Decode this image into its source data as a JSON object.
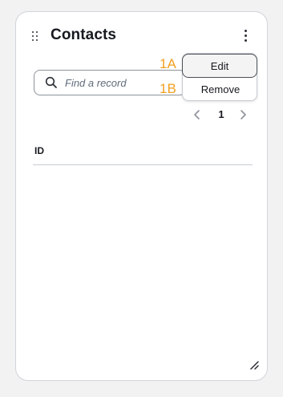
{
  "widget": {
    "title": "Contacts"
  },
  "search": {
    "placeholder": "Find a record"
  },
  "menu": {
    "items": [
      {
        "label": "Edit",
        "hint": "1A"
      },
      {
        "label": "Remove",
        "hint": "1B"
      }
    ]
  },
  "pagination": {
    "current_page": "1"
  },
  "table": {
    "columns": [
      "ID"
    ]
  },
  "icons": {
    "drag": "drag-handle-icon",
    "more": "more-vertical-icon",
    "search": "search-icon",
    "prev": "chevron-left-icon",
    "next": "chevron-right-icon",
    "resize": "resize-handle-icon"
  },
  "colors": {
    "hint": "#f0a020",
    "text": "#16191f"
  }
}
